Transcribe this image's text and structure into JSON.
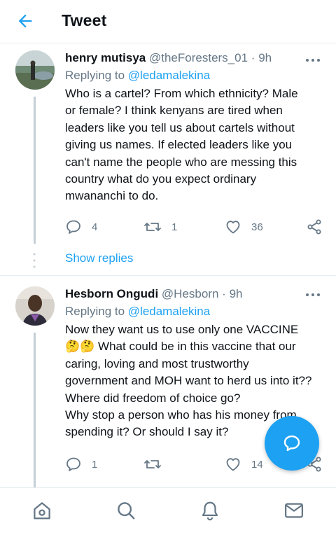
{
  "header": {
    "title": "Tweet"
  },
  "tweets": [
    {
      "name": "henry mutisya",
      "handle": "@theForesters_01",
      "separator": "·",
      "time": "9h",
      "replying_prefix": "Replying to ",
      "replying_to": "@ledamalekina",
      "lines": [
        "Who is a cartel? From which ethnicity? Male",
        "or female? I think kenyans are tired when",
        "leaders like you tell us about cartels without",
        "giving us names. If elected leaders like you",
        "can't name the people who are messing this",
        "country what do you expect ordinary",
        "mwananchi to do."
      ],
      "replies": "4",
      "retweets": "1",
      "likes": "36"
    },
    {
      "name": "Hesborn Ongudi",
      "handle": "@Hesborn",
      "separator": "·",
      "time": "9h",
      "replying_prefix": "Replying to ",
      "replying_to": "@ledamalekina",
      "lines": [
        "Now they want us to use only one VACCINE",
        "🤔🤔 What could be in this vaccine that our",
        "caring, loving and most trustworthy",
        "government and MOH want to herd us into it??",
        "Where did freedom of choice go?",
        "Why stop a person who has his money from",
        "spending it? Or should I say it?"
      ],
      "replies": "1",
      "retweets": "",
      "likes": "14"
    }
  ],
  "show_replies": "Show replies",
  "nav": [
    "home-icon",
    "search-icon",
    "notifications-icon",
    "messages-icon"
  ],
  "colors": {
    "accent": "#1da1f2",
    "secondary_text": "#657786",
    "divider": "#e6ecf0"
  }
}
